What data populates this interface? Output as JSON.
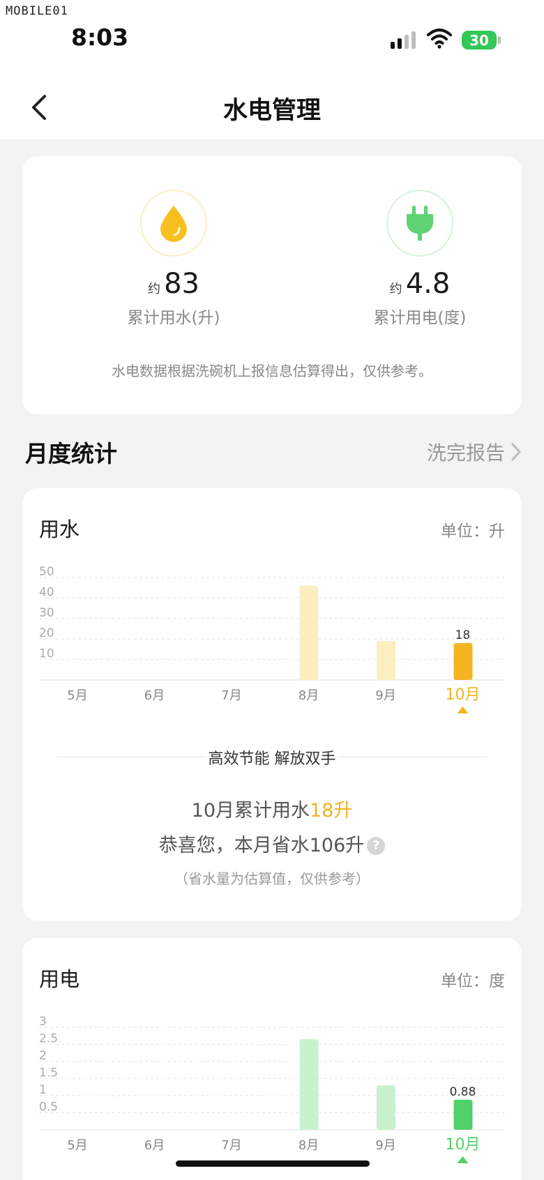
{
  "status_bar": {
    "watermark": "MOBILE01",
    "time": "8:03",
    "battery": "30"
  },
  "header": {
    "title": "水电管理"
  },
  "summary": {
    "water": {
      "approx": "约",
      "value": "83",
      "label": "累计用水(升)",
      "icon": "water-drop-icon"
    },
    "power": {
      "approx": "约",
      "value": "4.8",
      "label": "累计用电(度)",
      "icon": "plug-icon"
    },
    "note": "水电数据根据洗碗机上报信息估算得出，仅供参考。"
  },
  "monthly": {
    "title": "月度统计",
    "report_link": "洗完报告"
  },
  "water_chart": {
    "title": "用水",
    "unit": "单位：升",
    "slogan": "高效节能 解放双手",
    "month_total_prefix": "10月累计用水",
    "month_total_value": "18升",
    "saved": "恭喜您，本月省水106升",
    "saved_note": "（省水量为估算值，仅供参考）"
  },
  "power_chart": {
    "title": "用电",
    "unit": "单位：度"
  },
  "colors": {
    "water_accent": "#f3b422",
    "water_bar": "#fdeec2",
    "power_accent": "#52d16a",
    "power_bar": "#c8f1cd"
  },
  "chart_data": [
    {
      "type": "bar",
      "title": "用水",
      "categories": [
        "5月",
        "6月",
        "7月",
        "8月",
        "9月",
        "10月"
      ],
      "values": [
        0,
        0,
        0,
        46,
        19,
        18
      ],
      "yticks": [
        "10",
        "20",
        "30",
        "40",
        "50"
      ],
      "ylim": [
        0,
        50
      ],
      "selected": "10月",
      "data_labels": {
        "10月": "18"
      },
      "grid": true
    },
    {
      "type": "bar",
      "title": "用电",
      "categories": [
        "5月",
        "6月",
        "7月",
        "8月",
        "9月",
        "10月"
      ],
      "values": [
        0,
        0,
        0,
        2.65,
        1.3,
        0.88
      ],
      "yticks": [
        "0.5",
        "1",
        "1.5",
        "2",
        "2.5",
        "3"
      ],
      "ylim": [
        0,
        3
      ],
      "selected": "10月",
      "data_labels": {
        "10月": "0.88"
      },
      "grid": true
    }
  ]
}
